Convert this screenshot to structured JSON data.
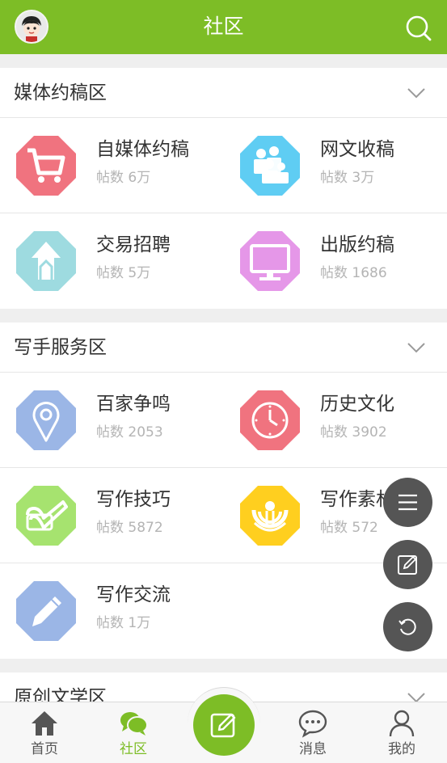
{
  "header": {
    "title": "社区"
  },
  "sections": [
    {
      "title": "媒体约稿区",
      "items": [
        {
          "name": "自媒体约稿",
          "count": "帖数 6万"
        },
        {
          "name": "网文收稿",
          "count": "帖数 3万"
        },
        {
          "name": "交易招聘",
          "count": "帖数 5万"
        },
        {
          "name": "出版约稿",
          "count": "帖数 1686"
        }
      ]
    },
    {
      "title": "写手服务区",
      "items": [
        {
          "name": "百家争鸣",
          "count": "帖数 2053"
        },
        {
          "name": "历史文化",
          "count": "帖数 3902"
        },
        {
          "name": "写作技巧",
          "count": "帖数 5872"
        },
        {
          "name": "写作素材",
          "count": "帖数 572"
        },
        {
          "name": "写作交流",
          "count": "帖数 1万"
        }
      ]
    },
    {
      "title": "原创文学区"
    }
  ],
  "nav": {
    "tabs": [
      {
        "label": "首页",
        "icon": "home-icon"
      },
      {
        "label": "社区",
        "icon": "chat-bubbles-icon"
      },
      {
        "label": "消息",
        "icon": "message-icon"
      },
      {
        "label": "我的",
        "icon": "user-icon"
      }
    ],
    "center_icon": "compose-icon"
  },
  "colors": {
    "brand": "#7dbd26",
    "icon_pink": "#f0737f",
    "icon_sky": "#5fcdf3",
    "icon_teal": "#9edbe0",
    "icon_purple": "#e597e8",
    "icon_blue": "#9bb6e6",
    "icon_green": "#a6e36f",
    "icon_yellow": "#ffcf1f"
  }
}
